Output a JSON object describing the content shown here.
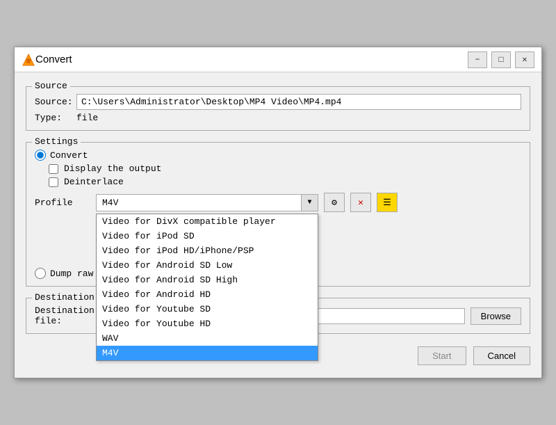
{
  "window": {
    "title": "Convert",
    "minimize_label": "−",
    "maximize_label": "□",
    "close_label": "✕"
  },
  "source": {
    "group_label": "Source",
    "source_key": "Source:",
    "source_value": "C:\\Users\\Administrator\\Desktop\\MP4 Video\\MP4.mp4",
    "type_key": "Type:",
    "type_value": "file"
  },
  "settings": {
    "group_label": "Settings",
    "convert_label": "Convert",
    "display_output_label": "Display the output",
    "deinterlace_label": "Deinterlace",
    "profile_label": "Profile",
    "profile_current": "M4V",
    "dump_raw_label": "Dump raw input"
  },
  "profile_options": [
    {
      "label": "Video for DivX compatible player",
      "selected": false
    },
    {
      "label": "Video for iPod SD",
      "selected": false
    },
    {
      "label": "Video for iPod HD/iPhone/PSP",
      "selected": false
    },
    {
      "label": "Video for Android SD Low",
      "selected": false
    },
    {
      "label": "Video for Android SD High",
      "selected": false
    },
    {
      "label": "Video for Android HD",
      "selected": false
    },
    {
      "label": "Video for Youtube SD",
      "selected": false
    },
    {
      "label": "Video for Youtube HD",
      "selected": false
    },
    {
      "label": "WAV",
      "selected": false
    },
    {
      "label": "M4V",
      "selected": true
    }
  ],
  "tools": {
    "settings_icon": "⚙",
    "delete_icon": "✕",
    "edit_icon": "☰"
  },
  "destination": {
    "group_label": "Destination",
    "dest_file_label": "Destination file:",
    "dest_value": "",
    "browse_label": "Browse"
  },
  "footer": {
    "start_label": "Start",
    "cancel_label": "Cancel"
  }
}
